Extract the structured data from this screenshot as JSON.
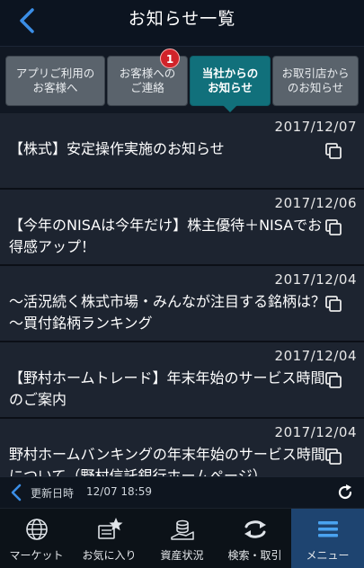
{
  "header": {
    "title": "お知らせ一覧"
  },
  "tabs": [
    {
      "label": "アプリご利用の\nお客様へ"
    },
    {
      "label": "お客様への\nご連絡",
      "badge": "1"
    },
    {
      "label": "当社からの\nお知らせ",
      "active": true
    },
    {
      "label": "お取引店から\nのお知らせ"
    }
  ],
  "notices": [
    {
      "date": "2017/12/07",
      "title": "【株式】安定操作実施のお知らせ"
    },
    {
      "date": "2017/12/06",
      "title": "【今年のNISAは今年だけ】株主優待＋NISAでお得感アップ！"
    },
    {
      "date": "2017/12/04",
      "title": "～活況続く株式市場・みんなが注目する銘柄は？～買付銘柄ランキング"
    },
    {
      "date": "2017/12/04",
      "title": "【野村ホームトレード】年末年始のサービス時間のご案内"
    },
    {
      "date": "2017/12/04",
      "title": "野村ホームバンキングの年末年始のサービス時間について（野村信託銀行ホームページ）"
    }
  ],
  "status": {
    "label": "更新日時",
    "time": "12/07 18:59"
  },
  "nav": [
    {
      "label": "マーケット",
      "icon": "globe-icon"
    },
    {
      "label": "お気に入り",
      "icon": "favorites-icon"
    },
    {
      "label": "資産状況",
      "icon": "assets-icon"
    },
    {
      "label": "検索・取引",
      "icon": "trade-icon"
    },
    {
      "label": "メニュー",
      "icon": "menu-icon",
      "active": true
    }
  ],
  "colors": {
    "active_tab": "#11707b",
    "badge": "#d1232a",
    "active_nav": "#1e4470",
    "accent": "#3b8ee6"
  }
}
